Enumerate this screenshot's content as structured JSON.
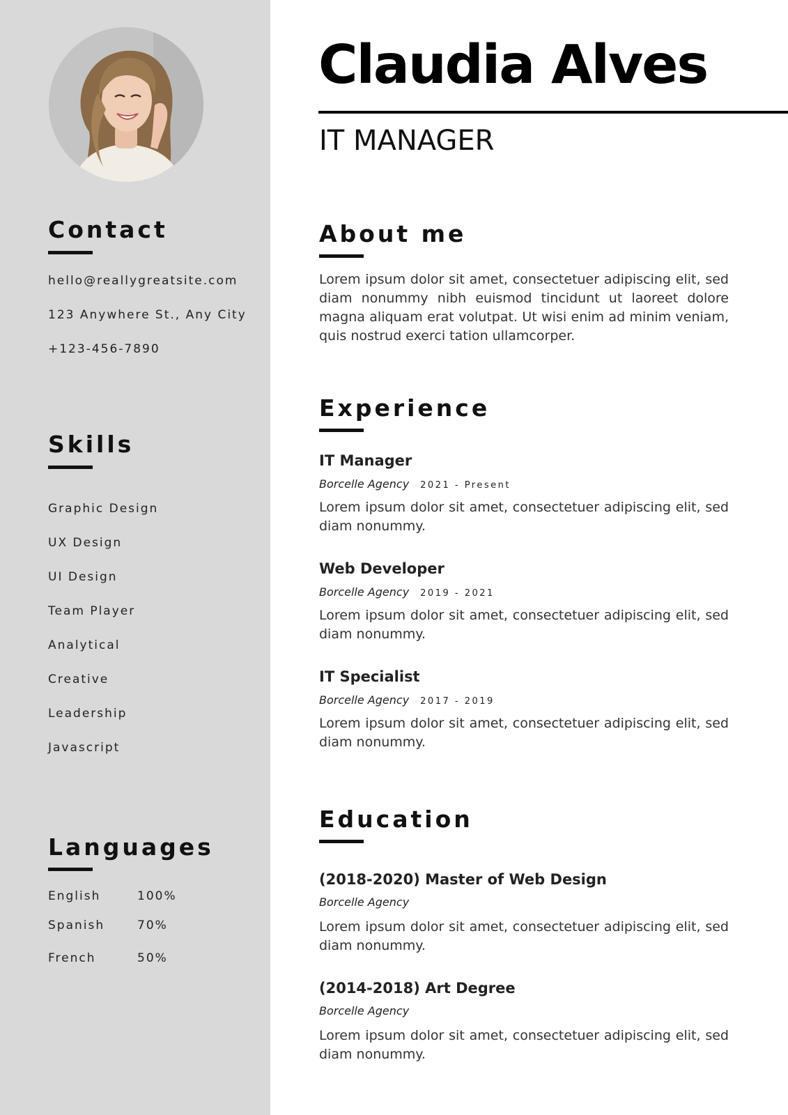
{
  "header": {
    "name": "Claudia Alves",
    "role": "IT MANAGER"
  },
  "contact": {
    "heading": "Contact",
    "email": "hello@reallygreatsite.com",
    "address": "123 Anywhere St., Any City",
    "phone": "+123-456-7890"
  },
  "skills": {
    "heading": "Skills",
    "items": [
      "Graphic Design",
      "UX Design",
      "UI Design",
      "Team Player",
      "Analytical",
      "Creative",
      "Leadership",
      "Javascript"
    ]
  },
  "languages": {
    "heading": "Languages",
    "items": [
      {
        "name": "English",
        "level": "100%"
      },
      {
        "name": "Spanish",
        "level": "70%"
      },
      {
        "name": "French",
        "level": "50%"
      }
    ]
  },
  "about": {
    "heading": "About me",
    "text": "Lorem ipsum dolor sit amet, consectetuer adipiscing elit, sed diam nonummy nibh euismod tincidunt ut laoreet dolore magna aliquam erat volutpat. Ut wisi enim ad minim veniam, quis nostrud exerci tation ullamcorper."
  },
  "experience": {
    "heading": "Experience",
    "items": [
      {
        "title": "IT Manager",
        "company": "Borcelle Agency",
        "dates": "2021 - Present",
        "text": "Lorem ipsum dolor sit amet, consectetuer adipiscing elit, sed diam nonummy."
      },
      {
        "title": "Web Developer",
        "company": "Borcelle Agency",
        "dates": "2019 - 2021",
        "text": "Lorem ipsum dolor sit amet, consectetuer adipiscing elit, sed diam nonummy."
      },
      {
        "title": "IT Specialist",
        "company": "Borcelle Agency",
        "dates": "2017 - 2019",
        "text": "Lorem ipsum dolor sit amet, consectetuer adipiscing elit, sed diam nonummy."
      }
    ]
  },
  "education": {
    "heading": "Education",
    "items": [
      {
        "title": "(2018-2020) Master of Web Design",
        "company": "Borcelle Agency",
        "text": "Lorem ipsum dolor sit amet, consectetuer adipiscing elit, sed diam nonummy."
      },
      {
        "title": "(2014-2018) Art Degree",
        "company": "Borcelle Agency",
        "text": "Lorem ipsum dolor sit amet, consectetuer adipiscing elit, sed diam nonummy."
      }
    ]
  },
  "colors": {
    "sidebar": "#d9d9d9",
    "text": "#111111"
  }
}
